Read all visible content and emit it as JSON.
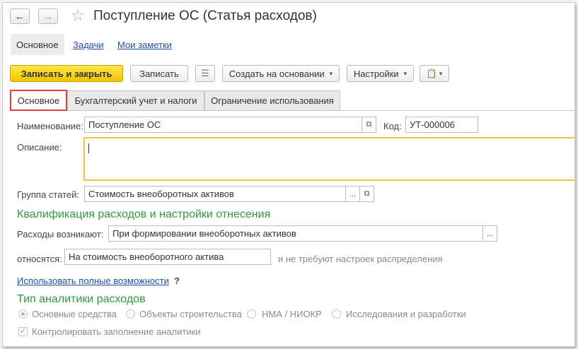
{
  "window": {
    "title": "Поступление ОС (Статья расходов)"
  },
  "nav": {
    "back_icon": "←",
    "forward_icon": "→",
    "star_icon": "☆"
  },
  "top_tabs": [
    "Основное",
    "Задачи",
    "Мои заметки"
  ],
  "toolbar": {
    "save_close": "Записать и закрыть",
    "save": "Записать",
    "list_icon": "☰",
    "create_based": "Создать на основании",
    "settings": "Настройки",
    "report_icon": "📋",
    "caret": "▾"
  },
  "form_tabs": [
    "Основное",
    "Бухгалтерский учет и налоги",
    "Ограничение использования"
  ],
  "fields": {
    "name_label": "Наименование:",
    "name_value": "Поступление ОС",
    "code_label": "Код:",
    "code_value": "УТ-000006",
    "description_label": "Описание:",
    "description_value": "",
    "group_label": "Группа статей:",
    "group_value": "Стоимость внеоборотных активов",
    "open_icon": "⧉",
    "select_icon": "..."
  },
  "qualification": {
    "heading": "Квалификация расходов и настройки отнесения",
    "arise_label": "Расходы возникают:",
    "arise_value": "При формировании внеоборотных активов",
    "relate_label": "относятся:",
    "relate_value": "На стоимость внеоборотного актива",
    "relate_note": "и не требуют настроек распределения"
  },
  "full_features_link": "Использовать полные возможности",
  "help_icon": "?",
  "analytics": {
    "heading": "Тип аналитики расходов",
    "options": [
      "Основные средства",
      "Объекты строительства",
      "НМА / НИОКР",
      "Исследования и разработки"
    ],
    "selected": "Основные средства",
    "check_label": "Контролировать заполнение аналитики",
    "check_mark": "✓"
  }
}
